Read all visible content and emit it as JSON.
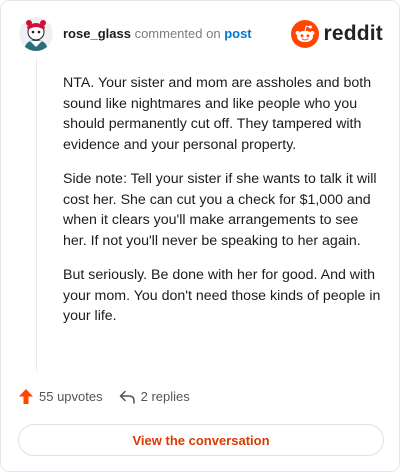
{
  "comment": {
    "username": "rose_glass",
    "action_text": "commented on",
    "post_link": "post",
    "paragraphs": [
      "NTA. Your sister and mom are assholes and both sound like nightmares and like people who you should permanently cut off. They tampered with evidence and your personal property.",
      "Side note: Tell your sister if she wants to talk it will cost her. She can cut you a check for $1,000 and when it clears you'll make arrangements to see her. If not you'll never be speaking to her again.",
      "But seriously. Be done with her for good. And with your mom. You don't need those kinds of people in your life."
    ]
  },
  "brand": {
    "wordmark": "reddit",
    "icon": "reddit-snoo-icon",
    "color": "#ff4500"
  },
  "stats": {
    "upvotes_label": "55 upvotes",
    "replies_label": "2 replies",
    "upvote_icon": "upvote-arrow-icon",
    "reply_icon": "reply-arrow-icon",
    "upvote_color": "#ff4500"
  },
  "cta": {
    "label": "View the conversation",
    "color": "#d93a00"
  }
}
